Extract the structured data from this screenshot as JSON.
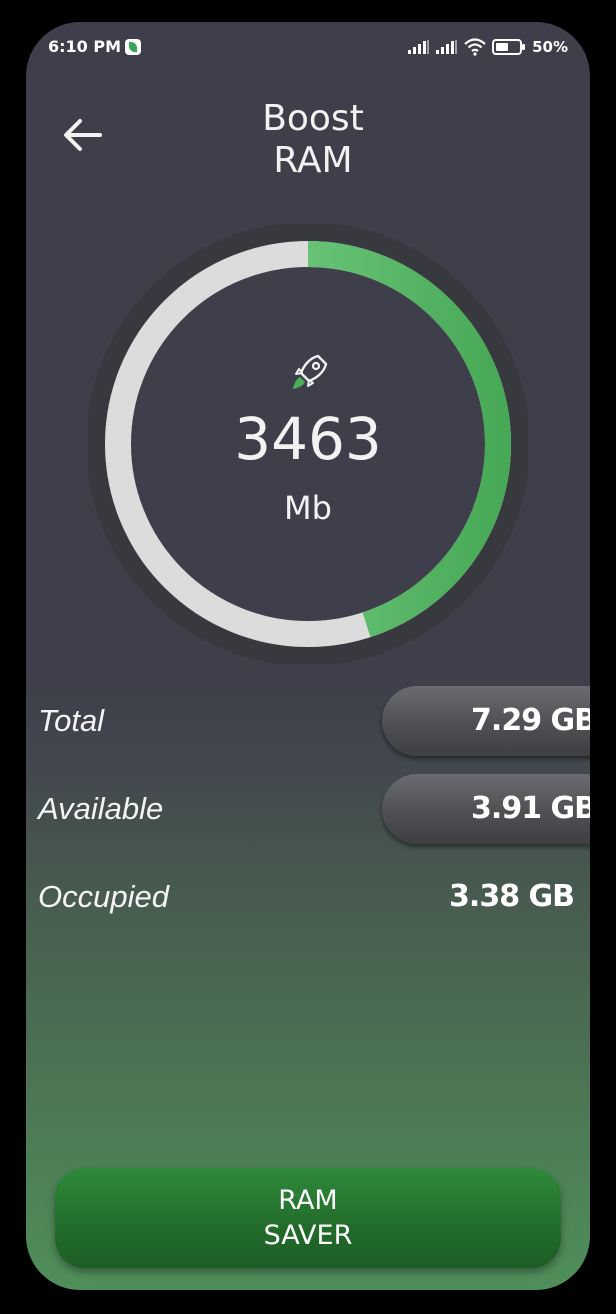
{
  "status_bar": {
    "time": "6:10 PM",
    "battery_percent": "50%",
    "icons": [
      "app-notification-icon",
      "signal-icon",
      "signal-icon",
      "wifi-icon",
      "battery-icon"
    ]
  },
  "header": {
    "title_line1": "Boost",
    "title_line2": "RAM",
    "back_icon": "arrow-left-icon"
  },
  "gauge": {
    "icon": "rocket-icon",
    "value": "3463",
    "unit": "Mb",
    "fill_fraction": 0.45,
    "colors": {
      "track": "#dcdcdc",
      "fill_start": "#88dc95",
      "fill_end": "#47a956",
      "ring_bg": "#38393f"
    }
  },
  "stats": [
    {
      "label": "Total",
      "value": "7.29 GB",
      "pill": true
    },
    {
      "label": "Available",
      "value": "3.91 GB",
      "pill": true
    },
    {
      "label": "Occupied",
      "value": "3.38 GB",
      "pill": false
    }
  ],
  "action_button": {
    "line1": "RAM",
    "line2": "SAVER"
  },
  "colors": {
    "background_top": "#3e3f4a",
    "background_bottom": "#4f8f5a",
    "button": "#236e2c",
    "accent": "#47a956"
  }
}
